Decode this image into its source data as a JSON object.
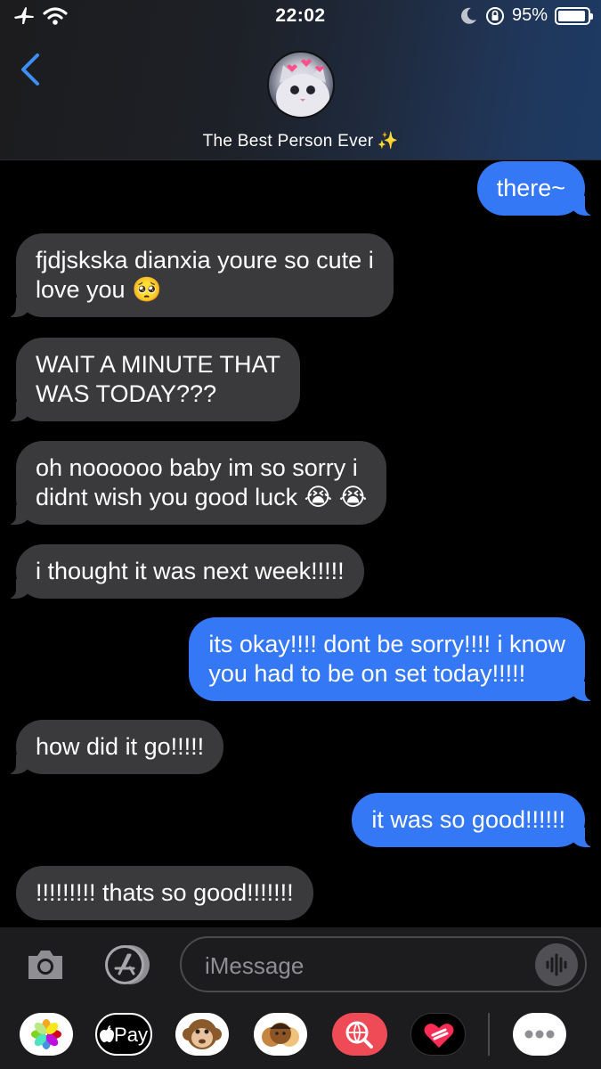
{
  "status_bar": {
    "time": "22:02",
    "battery_text": "95%",
    "battery_level": 0.95
  },
  "header": {
    "contact_name": "The Best Person Ever",
    "contact_emoji": "✨",
    "back_icon": "chevron-left-icon"
  },
  "messages": [
    {
      "from": "me",
      "text": "there~"
    },
    {
      "from": "them",
      "lines": [
        "fjdjskska dianxia youre so cute i",
        "love you 🥺"
      ]
    },
    {
      "from": "them",
      "lines": [
        "WAIT A MINUTE THAT",
        "WAS TODAY???"
      ]
    },
    {
      "from": "them",
      "lines": [
        "oh noooooo baby im so sorry i",
        "didnt wish you good luck 😭 😭"
      ]
    },
    {
      "from": "them",
      "text": "i thought it was next week!!!!!"
    },
    {
      "from": "me",
      "lines": [
        "its okay!!!! dont be sorry!!!! i know",
        "you had to be on set today!!!!!"
      ]
    },
    {
      "from": "them",
      "text": "how did it go!!!!!"
    },
    {
      "from": "me",
      "text": "it was so good!!!!!!"
    },
    {
      "from": "them",
      "text": "!!!!!!!!! thats so good!!!!!!!"
    }
  ],
  "compose": {
    "placeholder": "iMessage",
    "pay_label": "Pay"
  },
  "colors": {
    "outgoing_bubble": "#3478f6",
    "incoming_bubble": "#3a3a3c",
    "back_chevron": "#3d8ef7"
  }
}
